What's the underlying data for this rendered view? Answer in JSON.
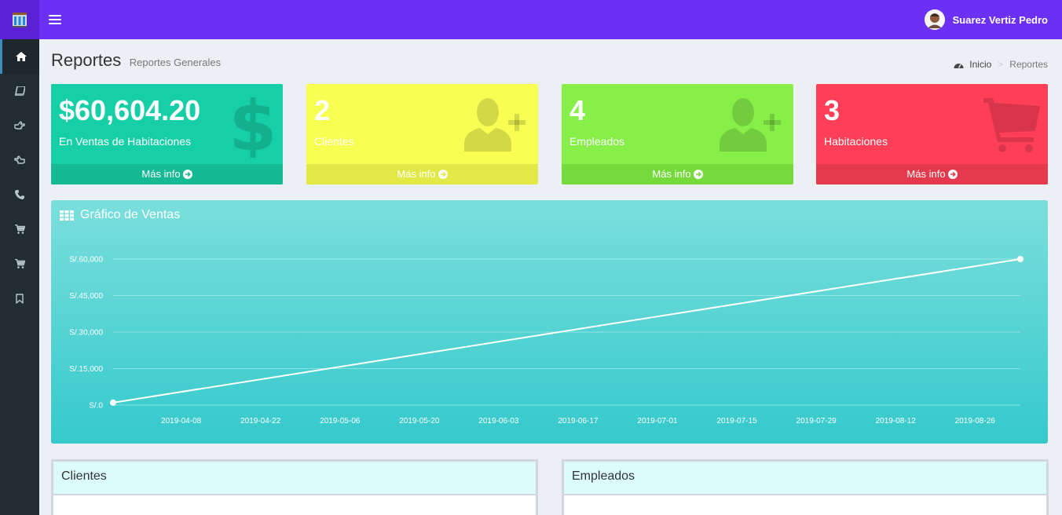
{
  "app": {
    "user_name": "Suarez Vertiz Pedro"
  },
  "sidebar": {
    "items": [
      {
        "icon": "home-icon",
        "active": true
      },
      {
        "icon": "book-icon",
        "active": false
      },
      {
        "icon": "hand-point-right-icon",
        "active": false
      },
      {
        "icon": "hand-point-left-icon",
        "active": false
      },
      {
        "icon": "phone-icon",
        "active": false
      },
      {
        "icon": "cart-icon",
        "active": false
      },
      {
        "icon": "cart-icon",
        "active": false
      },
      {
        "icon": "bookmark-icon",
        "active": false
      }
    ]
  },
  "header": {
    "title": "Reportes",
    "subtitle": "Reportes Generales",
    "breadcrumb": {
      "home": "Inicio",
      "current": "Reportes"
    }
  },
  "stats": [
    {
      "value": "$60,604.20",
      "label": "En Ventas de Habitaciones",
      "more": "Más info",
      "color": "#17cfa7",
      "icon": "dollar-icon"
    },
    {
      "value": "2",
      "label": "Clientes",
      "more": "Más info",
      "color": "#f8ff53",
      "icon": "user-plus-icon"
    },
    {
      "value": "4",
      "label": "Empleados",
      "more": "Más info",
      "color": "#86f048",
      "icon": "user-plus-icon"
    },
    {
      "value": "3",
      "label": "Habitaciones",
      "more": "Más info",
      "color": "#ff3f57",
      "icon": "shopping-cart-icon"
    }
  ],
  "chart": {
    "title": "Gráfico de Ventas"
  },
  "chart_data": {
    "type": "line",
    "title": "Gráfico de Ventas",
    "xlabel": "",
    "ylabel": "",
    "x_ticks": [
      "2019-04-08",
      "2019-04-22",
      "2019-05-06",
      "2019-05-20",
      "2019-06-03",
      "2019-06-17",
      "2019-07-01",
      "2019-07-15",
      "2019-07-29",
      "2019-08-12",
      "2019-08-26"
    ],
    "y_ticks": [
      "S/.0",
      "S/.15,000",
      "S/.30,000",
      "S/.45,000",
      "S/.60,000"
    ],
    "ylim": [
      0,
      60000
    ],
    "xlim": [
      "2019-03-27",
      "2019-09-03"
    ],
    "series": [
      {
        "points": [
          {
            "x": "2019-03-27",
            "y": 1000
          },
          {
            "x": "2019-09-03",
            "y": 60000
          }
        ]
      }
    ],
    "grid": true,
    "colors": {
      "line": "#ffffff",
      "grid": "rgba(255,255,255,0.35)"
    }
  },
  "panels": {
    "left_title": "Clientes",
    "right_title": "Empleados"
  }
}
